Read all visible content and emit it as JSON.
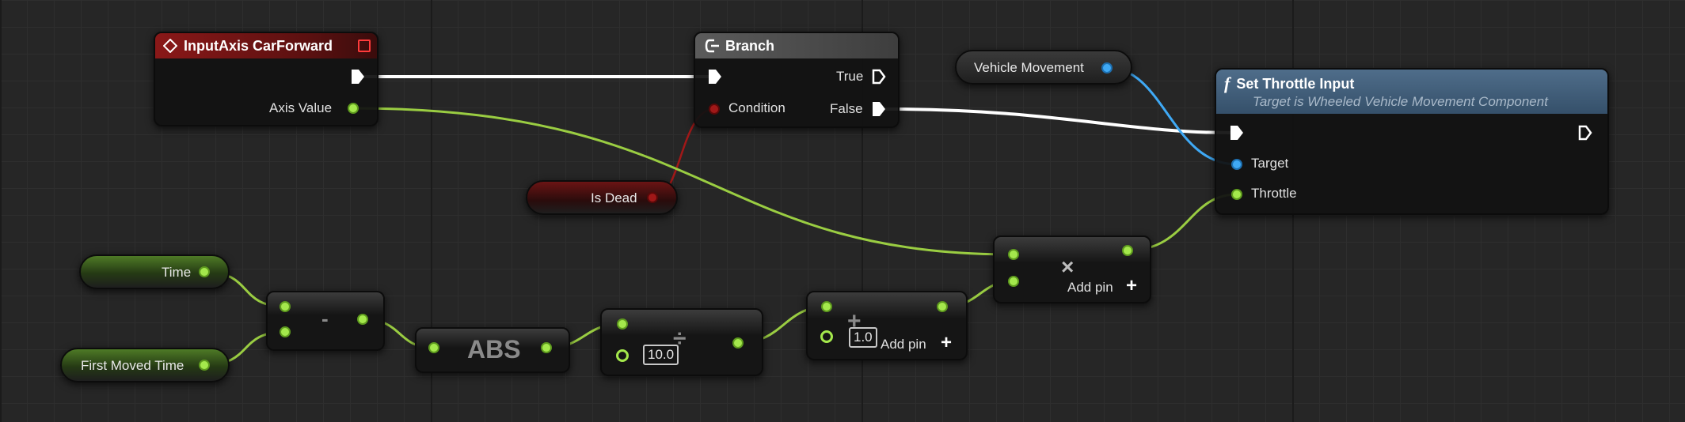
{
  "graph": {
    "input_axis": {
      "title": "InputAxis CarForward",
      "axis_value_label": "Axis Value"
    },
    "branch": {
      "title": "Branch",
      "condition_label": "Condition",
      "true_label": "True",
      "false_label": "False"
    },
    "set_throttle": {
      "title": "Set Throttle Input",
      "subtitle": "Target is Wheeled Vehicle Movement Component",
      "target_label": "Target",
      "throttle_label": "Throttle"
    },
    "variables": {
      "vehicle_movement": "Vehicle Movement",
      "is_dead": "Is Dead",
      "time": "Time",
      "first_moved_time": "First Moved Time"
    },
    "ops": {
      "subtract_symbol": "-",
      "abs_label": "ABS",
      "divide_constant": "10.0",
      "add_constant": "1.0",
      "add_pin_label": "Add pin",
      "add_pin_label_2": "Add pin",
      "multiply_symbol": "×",
      "divide_symbol": "÷",
      "add_symbol": "+",
      "plus_glyph": "+",
      "func_glyph": "f"
    }
  },
  "colors": {
    "float_pin": "#a4e84c",
    "object_pin": "#3fa9f5",
    "bool_pin": "#a01818",
    "exec_wire": "#ffffff",
    "event_header": "#8a1818",
    "function_header": "#4f6d8a"
  }
}
